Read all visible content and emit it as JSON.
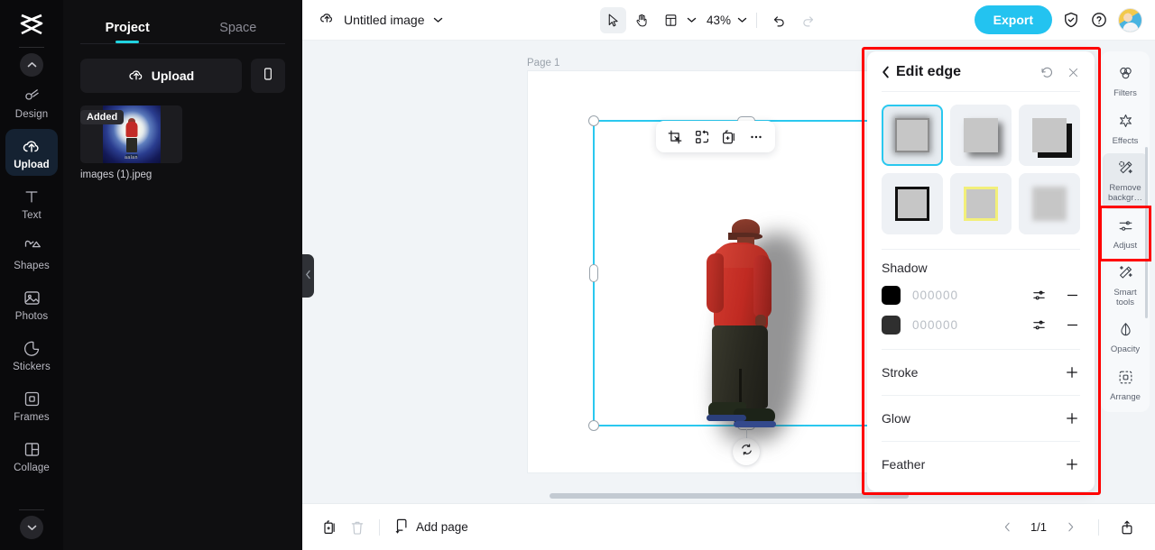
{
  "app": {
    "name": "CapCut Image Editor"
  },
  "left_rail": {
    "logo": "capcut-logo",
    "collapse_up": "chevron-up-icon",
    "collapse_down": "chevron-down-icon",
    "items": [
      {
        "label": "Design",
        "icon": "design-icon",
        "active": false
      },
      {
        "label": "Upload",
        "icon": "upload-cloud-icon",
        "active": true
      },
      {
        "label": "Text",
        "icon": "text-icon",
        "active": false
      },
      {
        "label": "Shapes",
        "icon": "shapes-icon",
        "active": false
      },
      {
        "label": "Photos",
        "icon": "photos-icon",
        "active": false
      },
      {
        "label": "Stickers",
        "icon": "stickers-icon",
        "active": false
      },
      {
        "label": "Frames",
        "icon": "frames-icon",
        "active": false
      },
      {
        "label": "Collage",
        "icon": "collage-icon",
        "active": false
      }
    ]
  },
  "project_panel": {
    "tabs": [
      {
        "label": "Project",
        "active": true
      },
      {
        "label": "Space",
        "active": false
      }
    ],
    "upload_button": "Upload",
    "mobile_button_icon": "mobile-phone-icon",
    "assets": [
      {
        "badge": "Added",
        "name": "images (1).jpeg",
        "caption": "aalan"
      }
    ]
  },
  "topbar": {
    "cloud_icon": "cloud-saved-icon",
    "doc_title": "Untitled image",
    "doc_dropdown_icon": "chevron-down-icon",
    "tools": [
      {
        "name": "select-tool",
        "icon": "cursor-arrow-icon",
        "selected": true
      },
      {
        "name": "hand-tool",
        "icon": "hand-icon",
        "selected": false
      },
      {
        "name": "layout-tool",
        "icon": "layout-panel-icon",
        "selected": false
      }
    ],
    "zoom_level": "43%",
    "zoom_dropdown_icon": "chevron-down-icon",
    "undo_icon": "undo-arrow-icon",
    "redo_icon": "redo-arrow-icon",
    "export_label": "Export",
    "shield_icon": "shield-check-icon",
    "help_icon": "question-circle-icon",
    "avatar": "user-avatar"
  },
  "canvas": {
    "page_label": "Page 1",
    "float_toolbar": [
      {
        "name": "crop-button",
        "icon": "crop-icon"
      },
      {
        "name": "cutout-button",
        "icon": "cutout-icon"
      },
      {
        "name": "duplicate-button",
        "icon": "duplicate-plus-icon"
      },
      {
        "name": "more-button",
        "icon": "ellipsis-icon"
      }
    ],
    "rotate_icon": "rotate-icon",
    "collapse_icon": "chevron-left-icon",
    "selection_color": "#2ac8ef"
  },
  "edge_panel": {
    "back_icon": "chevron-left-icon",
    "title": "Edit edge",
    "reset_icon": "reset-circular-arrow-icon",
    "close_icon": "close-x-icon",
    "presets": [
      {
        "name": "soft-shadow-all",
        "style": "p1",
        "active": true
      },
      {
        "name": "drop-shadow-offset",
        "style": "p2",
        "active": false
      },
      {
        "name": "hard-shadow-offset",
        "style": "p3",
        "active": false
      },
      {
        "name": "black-stroke",
        "style": "p4",
        "active": false
      },
      {
        "name": "yellow-glow",
        "style": "p5",
        "active": false
      },
      {
        "name": "feather-blur",
        "style": "p6",
        "active": false
      }
    ],
    "shadow": {
      "label": "Shadow",
      "entries": [
        {
          "color": "#000000",
          "hex_text": "000000",
          "settings_icon": "sliders-icon",
          "remove_icon": "minus-icon"
        },
        {
          "color": "#2f2f2f",
          "hex_text": "000000",
          "settings_icon": "sliders-icon",
          "remove_icon": "minus-icon"
        }
      ]
    },
    "accordions": [
      {
        "label": "Stroke",
        "add_icon": "plus-icon"
      },
      {
        "label": "Glow",
        "add_icon": "plus-icon"
      },
      {
        "label": "Feather",
        "add_icon": "plus-icon"
      }
    ],
    "highlight_color": "#ff0000"
  },
  "right_rail": {
    "items": [
      {
        "label": "Filters",
        "icon": "filters-circles-icon",
        "selected": false,
        "highlighted": false
      },
      {
        "label": "Effects",
        "icon": "effects-star-icon",
        "selected": false,
        "highlighted": false
      },
      {
        "label": "Remove backgr…",
        "icon": "remove-background-wand-icon",
        "selected": true,
        "highlighted": true
      },
      {
        "label": "Adjust",
        "icon": "adjust-sliders-icon",
        "selected": false,
        "highlighted": false
      },
      {
        "label": "Smart tools",
        "icon": "smart-tools-wand-icon",
        "selected": false,
        "highlighted": false
      },
      {
        "label": "Opacity",
        "icon": "opacity-droplet-icon",
        "selected": false,
        "highlighted": false
      },
      {
        "label": "Arrange",
        "icon": "arrange-dashed-square-icon",
        "selected": false,
        "highlighted": false
      }
    ]
  },
  "bottombar": {
    "duplicate_page_icon": "duplicate-page-icon",
    "delete_page_icon": "trash-icon",
    "add_page_label": "Add page",
    "add_page_icon": "add-page-icon",
    "prev_icon": "chevron-left-icon",
    "page_count": "1/1",
    "next_icon": "chevron-right-icon",
    "export_page_icon": "export-up-icon"
  }
}
